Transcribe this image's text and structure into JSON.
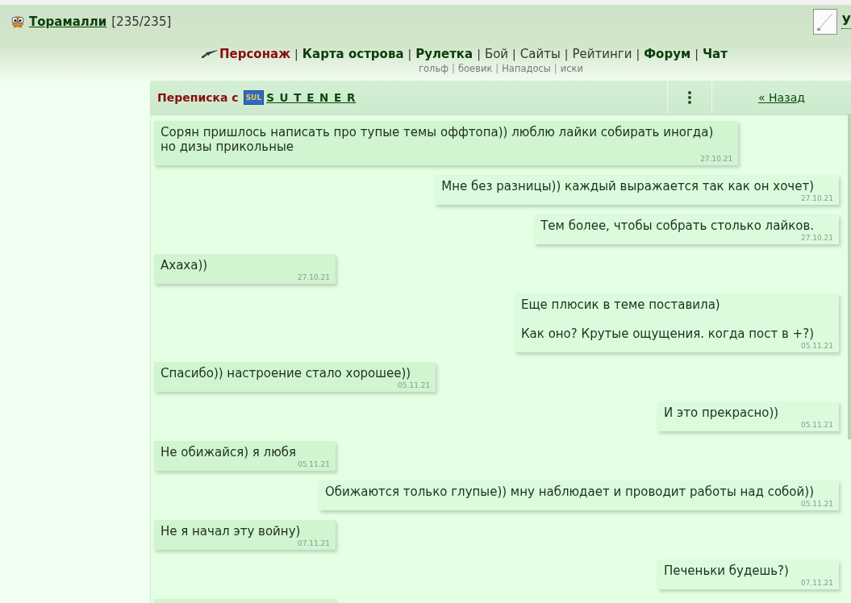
{
  "user": {
    "name": "Торамалли",
    "health": "[235/235]"
  },
  "top_right": {
    "link": "У"
  },
  "nav": {
    "separator": "|",
    "items": [
      {
        "label": "Персонаж",
        "selected": true,
        "bold": true
      },
      {
        "label": "Карта острова",
        "selected": false,
        "bold": true
      },
      {
        "label": "Рулетка",
        "selected": false,
        "bold": true
      },
      {
        "label": "Бой",
        "selected": false,
        "bold": false
      },
      {
        "label": "Сайты",
        "selected": false,
        "bold": false
      },
      {
        "label": "Рейтинги",
        "selected": false,
        "bold": false
      },
      {
        "label": "Форум",
        "selected": false,
        "bold": true
      },
      {
        "label": "Чат",
        "selected": false,
        "bold": true
      }
    ]
  },
  "sub_nav": {
    "separator": "|",
    "items": [
      "гольф",
      "боевик",
      "Нападосы",
      "иски"
    ]
  },
  "conversation": {
    "title": "Переписка с",
    "contact": {
      "clan_badge": "SUL",
      "name": "S U T E N E R"
    },
    "back_link": "« Назад",
    "messages": [
      {
        "kind": "incoming",
        "text": "Сорян пришлось написать про тупые темы оффтопа)) люблю лайки собирать иногда)\nно дизы прикольные",
        "date": "27.10.21"
      },
      {
        "kind": "outgoing",
        "text": "Мне без разницы)) каждый выражается так как он хочет)",
        "date": "27.10.21"
      },
      {
        "kind": "outgoing",
        "text": "Тем более, чтобы собрать столько лайков.",
        "date": "27.10.21"
      },
      {
        "kind": "incoming",
        "text": "Ахаха))",
        "date": "27.10.21"
      },
      {
        "kind": "outgoing",
        "text": "Еще плюсик в теме поставила)\n\nКак оно? Крутые ощущения. когда пост в +?)",
        "date": "05.11.21"
      },
      {
        "kind": "incoming",
        "text": "Спасибо)) настроение стало хорошее))",
        "date": "05.11.21"
      },
      {
        "kind": "outgoing",
        "text": "И это прекрасно))",
        "date": "05.11.21"
      },
      {
        "kind": "incoming",
        "text": "Не обижайся) я любя",
        "date": "05.11.21"
      },
      {
        "kind": "outgoing",
        "text": "Обижаются только глупые)) мну наблюдает и проводит работы над собой))",
        "date": "05.11.21"
      },
      {
        "kind": "incoming",
        "text": "Не я начал эту войну)",
        "date": "07.11.21"
      },
      {
        "kind": "outgoing",
        "text": "Печеньки будешь?)",
        "date": "07.11.21"
      },
      {
        "kind": "incoming"
      }
    ]
  }
}
